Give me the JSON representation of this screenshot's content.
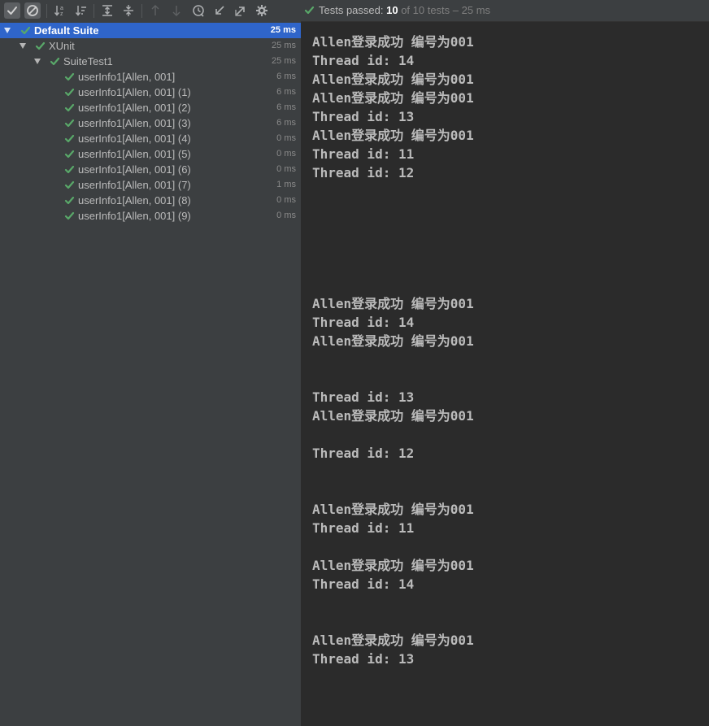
{
  "colors": {
    "success": "#59a869",
    "selection": "#2f65ca"
  },
  "toolbar": {
    "buttons": [
      {
        "name": "show-passed-button",
        "icon": "checkmark-icon",
        "active": true
      },
      {
        "name": "show-ignored-button",
        "icon": "ban-icon",
        "active": true
      },
      {
        "name": "sort-alphabetically-button",
        "icon": "sort-alpha-icon"
      },
      {
        "name": "sort-by-duration-button",
        "icon": "sort-duration-icon"
      },
      {
        "name": "expand-all-button",
        "icon": "expand-all-icon"
      },
      {
        "name": "collapse-all-button",
        "icon": "collapse-all-icon"
      },
      {
        "name": "previous-failed-button",
        "icon": "arrow-up-icon",
        "disabled": true
      },
      {
        "name": "next-failed-button",
        "icon": "arrow-down-icon",
        "disabled": true
      },
      {
        "name": "test-history-button",
        "icon": "history-clock-icon"
      },
      {
        "name": "import-tests-button",
        "icon": "import-arrow-icon"
      },
      {
        "name": "export-tests-button",
        "icon": "export-arrow-icon"
      },
      {
        "name": "settings-button",
        "icon": "gear-icon"
      }
    ]
  },
  "status": {
    "label": "Tests passed: ",
    "count": "10",
    "rest": " of 10 tests – 25 ms"
  },
  "tree": [
    {
      "name": "Default Suite",
      "time": "25 ms",
      "level": 0,
      "expanded": true,
      "selected": true
    },
    {
      "name": "XUnit",
      "time": "25 ms",
      "level": 1,
      "expanded": true
    },
    {
      "name": "SuiteTest1",
      "time": "25 ms",
      "level": 2,
      "expanded": true
    },
    {
      "name": "userInfo1[Allen, 001]",
      "time": "6 ms",
      "level": 3
    },
    {
      "name": "userInfo1[Allen, 001] (1)",
      "time": "6 ms",
      "level": 3
    },
    {
      "name": "userInfo1[Allen, 001] (2)",
      "time": "6 ms",
      "level": 3
    },
    {
      "name": "userInfo1[Allen, 001] (3)",
      "time": "6 ms",
      "level": 3
    },
    {
      "name": "userInfo1[Allen, 001] (4)",
      "time": "0 ms",
      "level": 3
    },
    {
      "name": "userInfo1[Allen, 001] (5)",
      "time": "0 ms",
      "level": 3
    },
    {
      "name": "userInfo1[Allen, 001] (6)",
      "time": "0 ms",
      "level": 3
    },
    {
      "name": "userInfo1[Allen, 001] (7)",
      "time": "1 ms",
      "level": 3
    },
    {
      "name": "userInfo1[Allen, 001] (8)",
      "time": "0 ms",
      "level": 3
    },
    {
      "name": "userInfo1[Allen, 001] (9)",
      "time": "0 ms",
      "level": 3
    }
  ],
  "console": [
    "Allen登录成功 编号为001",
    "Thread id: 14",
    "Allen登录成功 编号为001",
    "Allen登录成功 编号为001",
    "Thread id: 13",
    "Allen登录成功 编号为001",
    "Thread id: 11",
    "Thread id: 12",
    "",
    "",
    "",
    "",
    "",
    "",
    "Allen登录成功 编号为001",
    "Thread id: 14",
    "Allen登录成功 编号为001",
    "",
    "",
    "Thread id: 13",
    "Allen登录成功 编号为001",
    "",
    "Thread id: 12",
    "",
    "",
    "Allen登录成功 编号为001",
    "Thread id: 11",
    "",
    "Allen登录成功 编号为001",
    "Thread id: 14",
    "",
    "",
    "Allen登录成功 编号为001",
    "Thread id: 13",
    "",
    "",
    "",
    "==============================================="
  ]
}
